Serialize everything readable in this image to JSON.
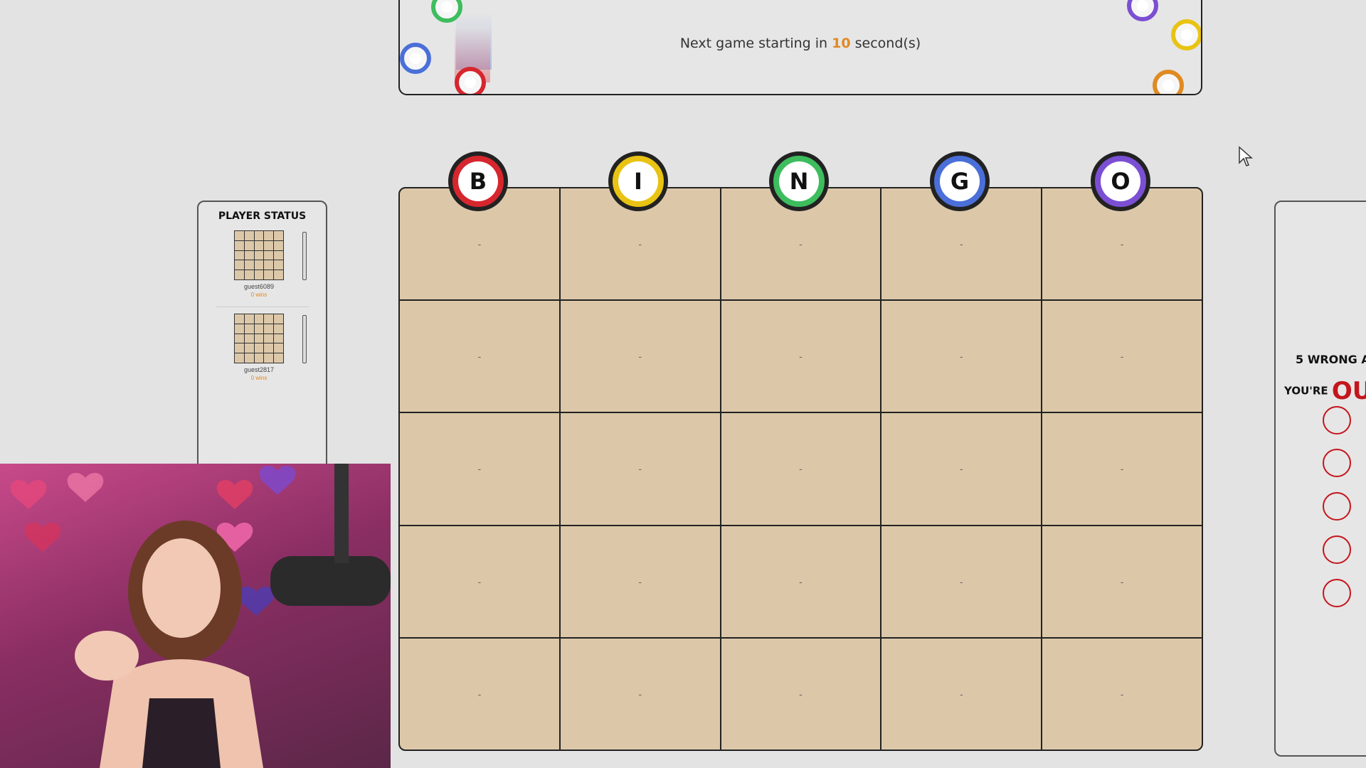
{
  "banner": {
    "prefix": "Next game starting in",
    "countdown": "10",
    "suffix": "second(s)"
  },
  "players_panel": {
    "title": "PLAYER STATUS",
    "players": [
      {
        "name": "guest6089",
        "wins": "0 wins"
      },
      {
        "name": "guest2817",
        "wins": "0 wins"
      }
    ]
  },
  "board": {
    "headers": [
      {
        "letter": "B",
        "color": "#d6262e"
      },
      {
        "letter": "I",
        "color": "#e8c313"
      },
      {
        "letter": "N",
        "color": "#3ebd5e"
      },
      {
        "letter": "G",
        "color": "#4a6fd8"
      },
      {
        "letter": "O",
        "color": "#7b4fd3"
      }
    ],
    "cells": [
      [
        "-",
        "-",
        "-",
        "-",
        "-"
      ],
      [
        "-",
        "-",
        "-",
        "-",
        "-"
      ],
      [
        "-",
        "-",
        "-",
        "-",
        "-"
      ],
      [
        "-",
        "-",
        "-",
        "-",
        "-"
      ],
      [
        "-",
        "-",
        "-",
        "-",
        "-"
      ]
    ]
  },
  "strikes_panel": {
    "line1": "5 WRONG A",
    "line2_prefix": "YOU'RE",
    "line2_out": "OU",
    "strikes_remaining": 5
  },
  "colors": {
    "countdown": "#e08a22",
    "strike_red": "#c4151c",
    "cell_bg": "#dcc8a9"
  }
}
